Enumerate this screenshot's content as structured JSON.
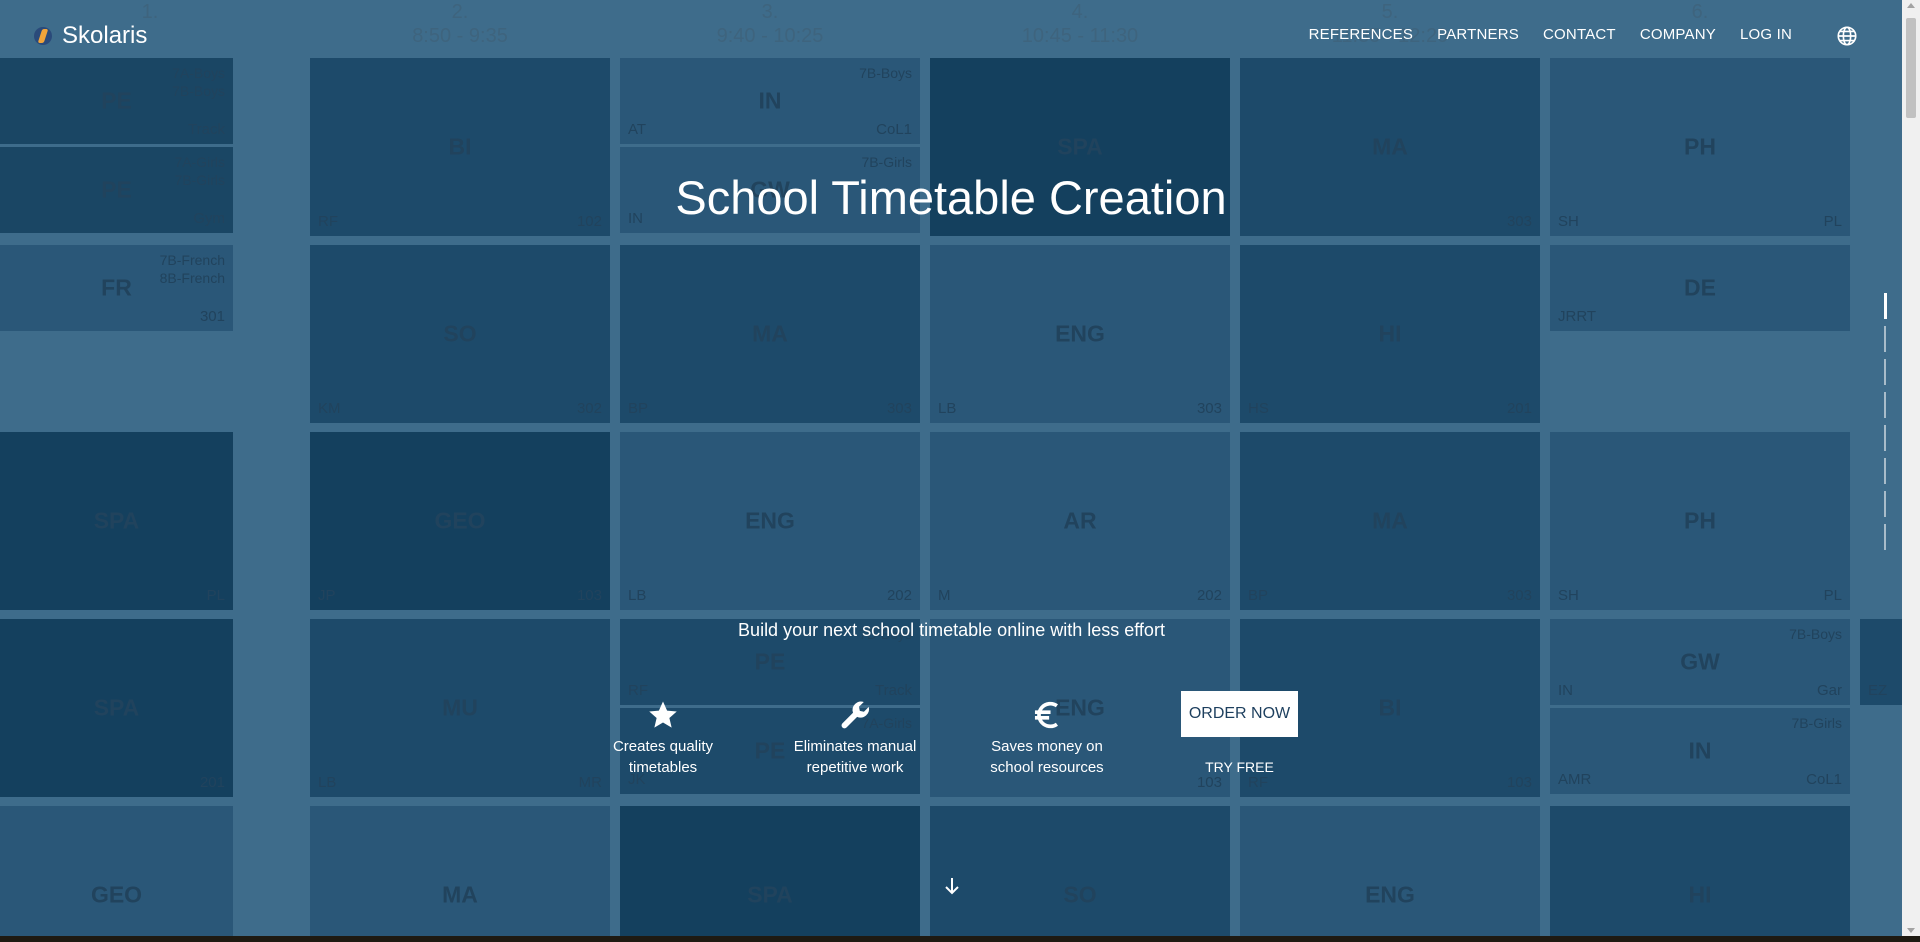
{
  "brand": {
    "name": "Skolaris"
  },
  "nav": {
    "items": [
      "REFERENCES",
      "PARTNERS",
      "CONTACT",
      "COMPANY",
      "LOG IN"
    ],
    "globe_icon": "globe-icon"
  },
  "hero": {
    "title": "School Timetable Creation",
    "tagline": "Build your next school timetable online with less effort",
    "features": [
      {
        "icon": "star-icon",
        "line1": "Creates quality",
        "line2": "timetables"
      },
      {
        "icon": "wrench-icon",
        "line1": "Eliminates manual",
        "line2": "repetitive work"
      },
      {
        "icon": "euro-icon",
        "line1": "Saves money on",
        "line2": "school resources"
      }
    ],
    "order_label": "ORDER NOW",
    "try_free_label": "TRY FREE"
  },
  "timetable": {
    "periods": [
      {
        "num": "1.",
        "time": ""
      },
      {
        "num": "2.",
        "time": "8:50 - 9:35"
      },
      {
        "num": "3.",
        "time": "9:40 - 10:25"
      },
      {
        "num": "4.",
        "time": "10:45 - 11:30"
      },
      {
        "num": "5.",
        "time": "11:35 - 12:20"
      },
      {
        "num": "6.",
        "time": ""
      }
    ],
    "cells": [
      {
        "subj": "PE",
        "tl": "",
        "tr": "Track",
        "grp": "7A-Boys\n7B-Boys",
        "shade": 2
      },
      {
        "subj": "PE",
        "tl": "",
        "tr": "Gym",
        "grp": "7A-Girls\n7B-Girls",
        "shade": 2
      },
      {
        "subj": "BI",
        "tl": "RF",
        "tr": "102",
        "grp": "",
        "shade": 1
      },
      {
        "subj": "IN",
        "tl": "AT",
        "tr": "CoL1",
        "grp": "7B-Boys",
        "shade": 0
      },
      {
        "subj": "GW",
        "tl": "IN",
        "tr": "",
        "grp": "7B-Girls",
        "shade": 0
      },
      {
        "subj": "SPA",
        "tl": "",
        "tr": "",
        "grp": "",
        "shade": 3
      },
      {
        "subj": "MA",
        "tl": "",
        "tr": "303",
        "grp": "",
        "shade": 1
      },
      {
        "subj": "PH",
        "tl": "SH",
        "tr": "PL",
        "grp": "",
        "shade": 0
      },
      {
        "subj": "FR",
        "tl": "",
        "tr": "301",
        "grp": "7B-French\n8B-French",
        "shade": 0
      },
      {
        "subj": "SO",
        "tl": "KM",
        "tr": "302",
        "grp": "",
        "shade": 1
      },
      {
        "subj": "MA",
        "tl": "BP",
        "tr": "303",
        "grp": "",
        "shade": 1
      },
      {
        "subj": "ENG",
        "tl": "LB",
        "tr": "303",
        "grp": "",
        "shade": 0
      },
      {
        "subj": "HI",
        "tl": "HS",
        "tr": "201",
        "grp": "",
        "shade": 1
      },
      {
        "subj": "DE",
        "tl": "JRRT",
        "tr": "",
        "grp": "",
        "shade": 0
      },
      {
        "subj": "SPA",
        "tl": "",
        "tr": "PL",
        "grp": "",
        "shade": 3
      },
      {
        "subj": "GEO",
        "tl": "JP",
        "tr": "103",
        "grp": "",
        "shade": 3
      },
      {
        "subj": "ENG",
        "tl": "LB",
        "tr": "202",
        "grp": "",
        "shade": 0
      },
      {
        "subj": "AR",
        "tl": "M",
        "tr": "202",
        "grp": "",
        "shade": 0
      },
      {
        "subj": "MA",
        "tl": "BP",
        "tr": "303",
        "grp": "",
        "shade": 1
      },
      {
        "subj": "PH",
        "tl": "SH",
        "tr": "PL",
        "grp": "",
        "shade": 0
      },
      {
        "subj": "SPA",
        "tl": "",
        "tr": "201",
        "grp": "",
        "shade": 3
      },
      {
        "subj": "MU",
        "tl": "LB",
        "tr": "MR",
        "grp": "",
        "shade": 1
      },
      {
        "subj": "PE",
        "tl": "RF",
        "tr": "Track",
        "grp": "7B-Boys",
        "shade": 1
      },
      {
        "subj": "PE",
        "tl": "JK",
        "tr": "",
        "grp": "7A-Girls",
        "shade": 1
      },
      {
        "subj": "ENG",
        "tl": "",
        "tr": "103",
        "grp": "",
        "shade": 0
      },
      {
        "subj": "BI",
        "tl": "RF",
        "tr": "103",
        "grp": "",
        "shade": 1
      },
      {
        "subj": "GW",
        "tl": "IN",
        "tr": "Gar",
        "grp": "7B-Boys",
        "shade": 0
      },
      {
        "subj": "IN",
        "tl": "AMR",
        "tr": "CoL1",
        "grp": "7B-Girls",
        "shade": 0
      },
      {
        "subj": "F",
        "tl": "EZ",
        "tr": "",
        "grp": "",
        "shade": 1
      },
      {
        "subj": "GEO",
        "tl": "",
        "tr": "",
        "grp": "",
        "shade": 0
      },
      {
        "subj": "MA",
        "tl": "",
        "tr": "",
        "grp": "",
        "shade": 0
      },
      {
        "subj": "SPA",
        "tl": "",
        "tr": "",
        "grp": "",
        "shade": 3
      },
      {
        "subj": "SO",
        "tl": "",
        "tr": "",
        "grp": "",
        "shade": 1
      },
      {
        "subj": "ENG",
        "tl": "",
        "tr": "",
        "grp": "",
        "shade": 0
      },
      {
        "subj": "HI",
        "tl": "",
        "tr": "",
        "grp": "",
        "shade": 1
      }
    ],
    "shades": [
      "#2f5e80",
      "#1e4d6e",
      "#1a4766",
      "#123f5e"
    ]
  },
  "side_nav": {
    "count": 8,
    "active": 0
  }
}
